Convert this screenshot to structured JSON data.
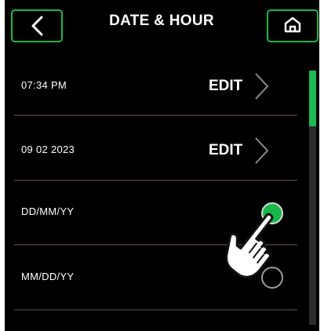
{
  "header": {
    "title": "DATE & HOUR",
    "back_icon": "chevron-left-icon",
    "home_icon": "home-icon"
  },
  "settings": {
    "time": {
      "value": "07:34 PM",
      "action": "EDIT"
    },
    "date": {
      "value": "09 02 2023",
      "action": "EDIT"
    },
    "formats": [
      {
        "label": "DD/MM/YY",
        "selected": true
      },
      {
        "label": "MM/DD/YY",
        "selected": false
      }
    ]
  },
  "scrollbar": {
    "position_fraction": 0.0,
    "visible_fraction": 0.22
  },
  "colors": {
    "accent": "#19b84a",
    "background": "#000000",
    "divider": "#3a2a2a",
    "text": "#ffffff"
  },
  "overlay_icon": "hand-pointer-icon"
}
